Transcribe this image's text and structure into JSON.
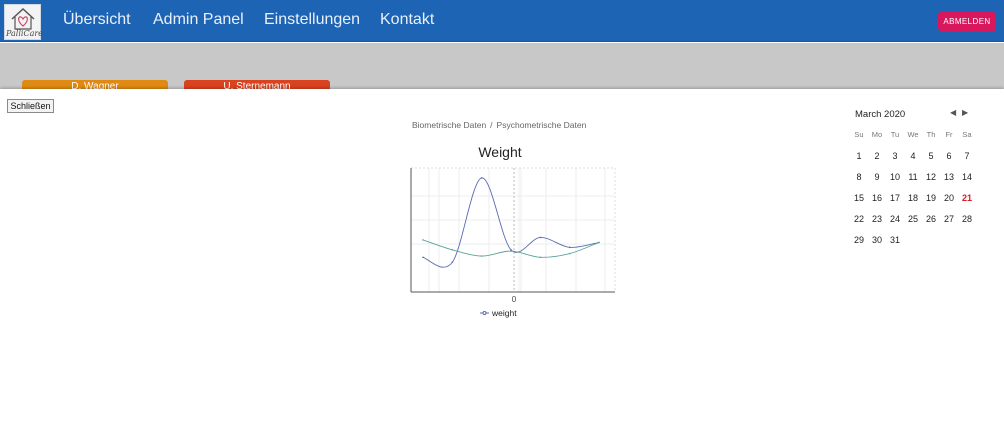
{
  "app": {
    "logo_text": "PalliCare"
  },
  "nav": {
    "items": [
      {
        "label": "Übersicht"
      },
      {
        "label": "Admin Panel"
      },
      {
        "label": "Einstellungen"
      },
      {
        "label": "Kontakt"
      }
    ],
    "logout_label": "ABMELDEN"
  },
  "patient_tabs": [
    {
      "label": "D. Wagner",
      "color": "#e08a14"
    },
    {
      "label": "U. Sternemann",
      "color": "#d9431f"
    }
  ],
  "panel": {
    "close_label": "Schließen",
    "breadcrumb": {
      "items": [
        "Biometrische Daten",
        "Psychometrische Daten"
      ],
      "separator": "/"
    }
  },
  "chart_data": {
    "type": "line",
    "title": "Weight",
    "x_tick_labels": [
      "0"
    ],
    "legend": {
      "label": "weight",
      "placement": "bottom"
    },
    "grid": true,
    "series": [
      {
        "name": "weight",
        "color": "#5a6bb0",
        "values": [
          0.28,
          0.24,
          0.92,
          0.34,
          0.44,
          0.36,
          0.4
        ]
      },
      {
        "color": "#5aa39a",
        "values": [
          0.42,
          0.34,
          0.29,
          0.33,
          0.28,
          0.31,
          0.4
        ]
      }
    ]
  },
  "calendar": {
    "month_label": "March 2020",
    "prev_icon": "◀",
    "next_icon": "▶",
    "weekdays": [
      "Su",
      "Mo",
      "Tu",
      "We",
      "Th",
      "Fr",
      "Sa"
    ],
    "weeks": [
      [
        "1",
        "2",
        "3",
        "4",
        "5",
        "6",
        "7"
      ],
      [
        "8",
        "9",
        "10",
        "11",
        "12",
        "13",
        "14"
      ],
      [
        "15",
        "16",
        "17",
        "18",
        "19",
        "20",
        "21"
      ],
      [
        "22",
        "23",
        "24",
        "25",
        "26",
        "27",
        "28"
      ],
      [
        "29",
        "30",
        "31",
        "",
        "",
        "",
        ""
      ]
    ],
    "selected_day": "21",
    "selected_color": "#d81b2a"
  }
}
